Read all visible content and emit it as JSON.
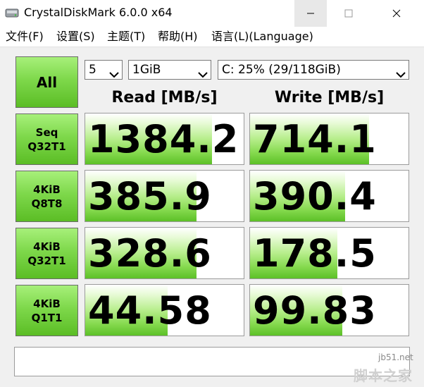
{
  "window": {
    "title": "CrystalDiskMark 6.0.0 x64",
    "minimize_icon": "minimize-icon",
    "maximize_icon": "maximize-icon",
    "close_icon": "close-icon"
  },
  "menu": [
    "文件(F)",
    "设置(S)",
    "主题(T)",
    "帮助(H)",
    "语言(L)(Language)"
  ],
  "controls": {
    "all_label": "All",
    "count": "5",
    "size": "1GiB",
    "drive": "C: 25% (29/118GiB)"
  },
  "columns": {
    "read": "Read [MB/s]",
    "write": "Write [MB/s]"
  },
  "tests": [
    {
      "line1": "Seq",
      "line2": "Q32T1",
      "read": "1384.2",
      "write": "714.1",
      "read_fill": 0.8,
      "write_fill": 0.75
    },
    {
      "line1": "4KiB",
      "line2": "Q8T8",
      "read": "385.9",
      "write": "390.4",
      "read_fill": 0.7,
      "write_fill": 0.6
    },
    {
      "line1": "4KiB",
      "line2": "Q32T1",
      "read": "328.6",
      "write": "178.5",
      "read_fill": 0.7,
      "write_fill": 0.55
    },
    {
      "line1": "4KiB",
      "line2": "Q1T1",
      "read": "44.58",
      "write": "99.83",
      "read_fill": 0.52,
      "write_fill": 0.58
    }
  ],
  "status_text": "",
  "watermark": {
    "site": "jb51.net",
    "brand": "脚本之家"
  },
  "colors": {
    "button_green": "#7ed84b",
    "bar_green": "#84d94d"
  }
}
